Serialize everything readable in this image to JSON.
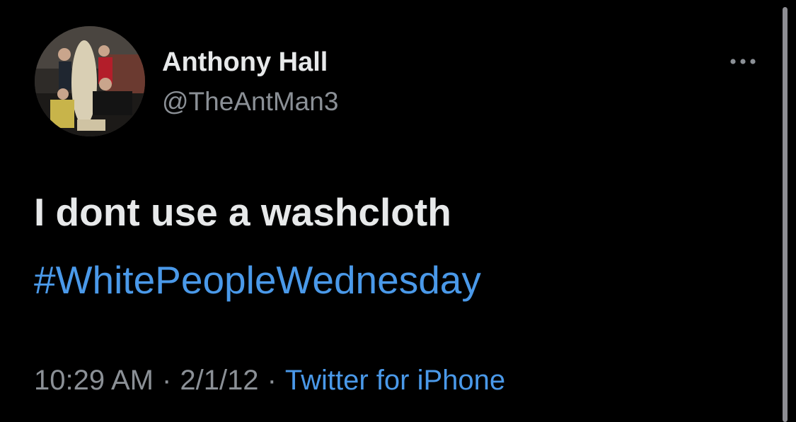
{
  "author": {
    "display_name": "Anthony Hall",
    "handle": "@TheAntMan3"
  },
  "tweet": {
    "text": "I dont use a washcloth",
    "hashtag": "#WhitePeopleWednesday"
  },
  "meta": {
    "time": "10:29 AM",
    "separator": "·",
    "date": "2/1/12",
    "source": "Twitter for iPhone"
  },
  "icons": {
    "more": "more-horizontal-icon",
    "avatar": "profile-photo"
  },
  "colors": {
    "background": "#000000",
    "primary_text": "#e7e9ea",
    "secondary_text": "#8b9096",
    "link": "#4a99e9"
  }
}
